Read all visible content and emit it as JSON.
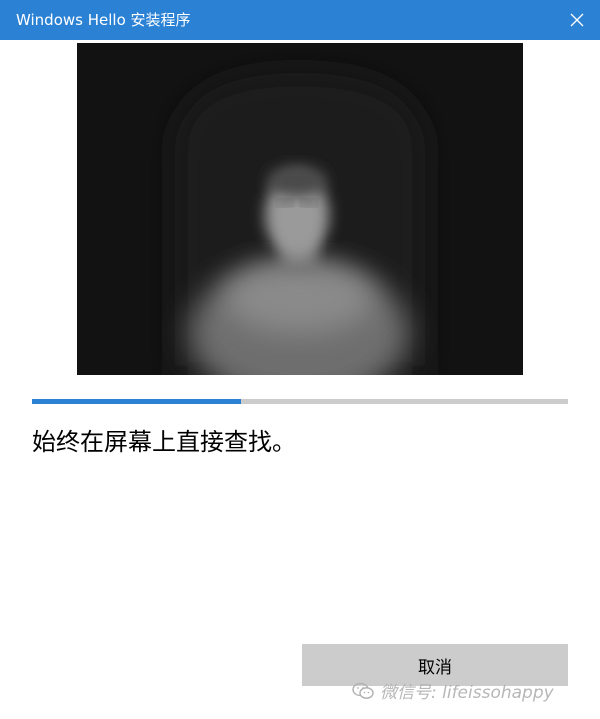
{
  "window": {
    "title": "Windows Hello 安装程序",
    "close_icon": "close-icon",
    "accent_color": "#2b82d5"
  },
  "camera": {
    "description_icon": "camera-preview"
  },
  "progress": {
    "fraction": 0.39
  },
  "message": "始终在屏幕上直接查找。",
  "buttons": {
    "cancel_label": "取消"
  },
  "watermark": {
    "text": "微信号: lifeissohappy",
    "icon": "wechat-icon"
  }
}
